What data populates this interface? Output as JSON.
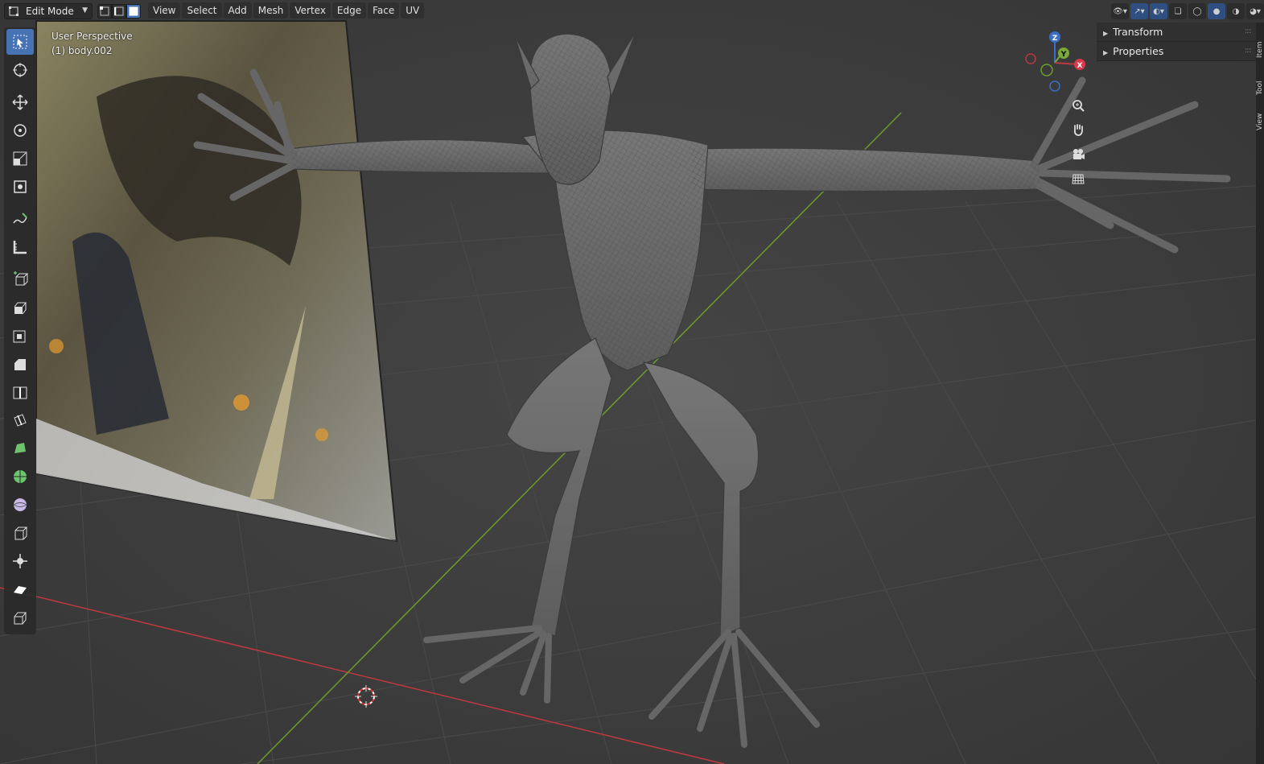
{
  "header": {
    "mode": "Edit Mode",
    "select_modes": [
      "vertex",
      "edge",
      "face"
    ],
    "active_select_mode": "face",
    "menu": [
      "View",
      "Select",
      "Add",
      "Mesh",
      "Vertex",
      "Edge",
      "Face",
      "UV"
    ]
  },
  "viewport": {
    "perspective": "User Perspective",
    "object": "(1) body.002",
    "colors": {
      "background": "#3d3d3d",
      "x_axis": "#c0393f",
      "y_axis": "#6e9b2a",
      "mesh": "#6a6a6a",
      "active_tool": "#4772b3"
    }
  },
  "toolbar": {
    "tools": [
      "select-box",
      "cursor",
      "move",
      "rotate",
      "scale",
      "transform",
      "annotate",
      "measure",
      "add-cube",
      "extrude-region",
      "inset-faces",
      "bevel",
      "loop-cut",
      "knife",
      "poly-build",
      "spin",
      "smooth",
      "edge-slide",
      "shrink-fatten",
      "shear",
      "rip-region"
    ],
    "active": "select-box"
  },
  "gizmo": {
    "axes": [
      "Z",
      "Y",
      "X"
    ]
  },
  "sidebar": {
    "panels": [
      "Transform",
      "Properties"
    ],
    "tabs": [
      "Item",
      "Tool",
      "View"
    ]
  }
}
